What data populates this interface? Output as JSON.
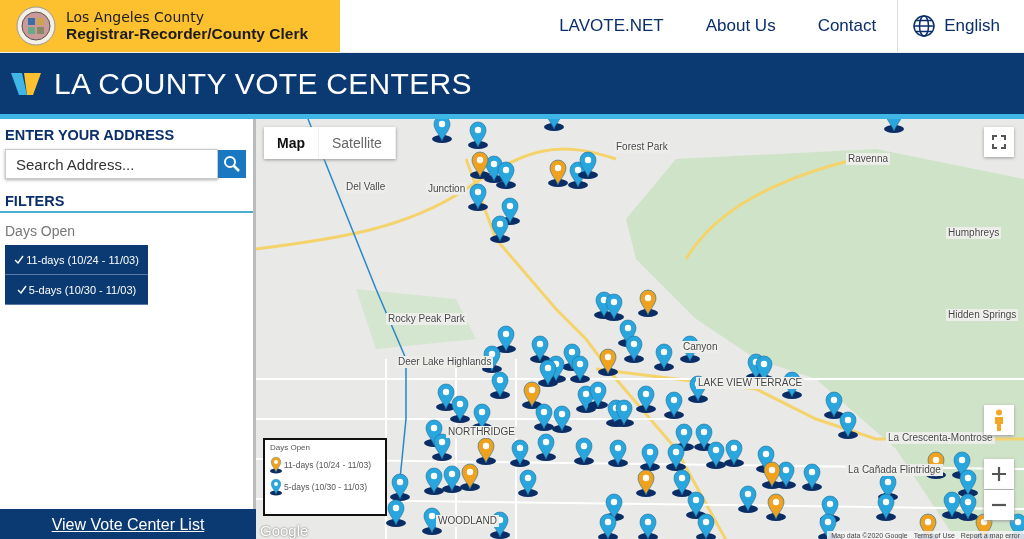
{
  "header": {
    "agency_line1": "Los Angeles County",
    "agency_line2": "Registrar-Recorder/County Clerk",
    "nav": [
      {
        "label": "LAVOTE.NET"
      },
      {
        "label": "About Us"
      },
      {
        "label": "Contact"
      }
    ],
    "language": "English"
  },
  "banner": {
    "title": "LA COUNTY VOTE CENTERS"
  },
  "sidebar": {
    "address_heading": "ENTER YOUR ADDRESS",
    "search": {
      "placeholder": "Search Address..."
    },
    "filters_heading": "FILTERS",
    "filter_group": "Days Open",
    "filters": [
      {
        "label": "11-days (10/24 - 11/03)",
        "selected": true
      },
      {
        "label": "5-days (10/30 - 11/03)",
        "selected": true
      }
    ],
    "list_link": "View Vote Center List"
  },
  "map": {
    "map_types": [
      {
        "label": "Map",
        "selected": true
      },
      {
        "label": "Satellite",
        "selected": false
      }
    ],
    "places": [
      {
        "label": "Forest Park"
      },
      {
        "label": "Ravenna"
      },
      {
        "label": "Junction"
      },
      {
        "label": "Del Valle"
      },
      {
        "label": "Humphreys"
      },
      {
        "label": "Rocky Peak Park"
      },
      {
        "label": "Hidden Springs"
      },
      {
        "label": "Deer Lake Highlands"
      },
      {
        "label": "Canyon"
      },
      {
        "label": "LAKE VIEW TERRACE"
      },
      {
        "label": "La Crescenta-Montrose"
      },
      {
        "label": "La Cañada Flintridge"
      },
      {
        "label": "NORTHRIDGE"
      },
      {
        "label": "WOODLAND"
      }
    ],
    "legend": {
      "title": "Days Open",
      "items": [
        {
          "label": "11-days (10/24 - 11/03)",
          "kind": "eleven"
        },
        {
          "label": "5-days (10/30 - 11/03)",
          "kind": "five"
        }
      ]
    },
    "logo": "Google",
    "attribution": "Map data ©2020 Google",
    "terms": "Terms of Use",
    "report": "Report a map error"
  }
}
